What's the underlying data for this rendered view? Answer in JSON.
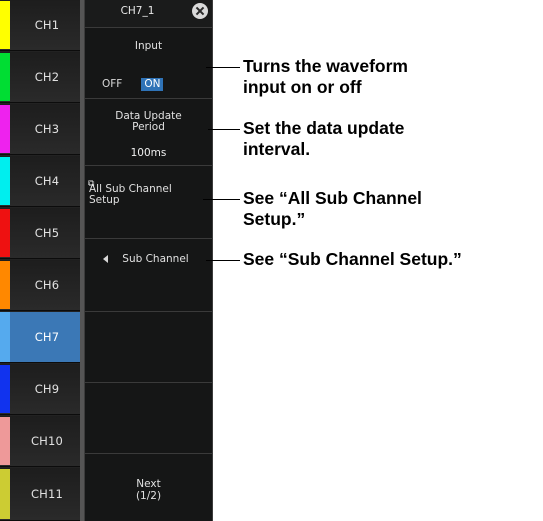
{
  "channels": [
    {
      "label": "CH1",
      "color": "#ffff00"
    },
    {
      "label": "CH2",
      "color": "#00dd33"
    },
    {
      "label": "CH3",
      "color": "#ee22ee"
    },
    {
      "label": "CH4",
      "color": "#00eeee"
    },
    {
      "label": "CH5",
      "color": "#ee1111"
    },
    {
      "label": "CH6",
      "color": "#ff8800"
    },
    {
      "label": "CH7",
      "color": "#55aaee",
      "selected": true
    },
    {
      "label": "CH9",
      "color": "#1133ee"
    },
    {
      "label": "CH10",
      "color": "#ee9999"
    },
    {
      "label": "CH11",
      "color": "#cccc33"
    }
  ],
  "panel": {
    "title": "CH7_1",
    "input": {
      "label": "Input",
      "off": "OFF",
      "on": "ON",
      "state": "ON"
    },
    "data_update": {
      "label_line1": "Data Update",
      "label_line2": "Period",
      "value": "100ms"
    },
    "all_sub": {
      "label_line1": "All Sub Channel",
      "label_line2": "Setup"
    },
    "sub_channel": {
      "label": "Sub Channel"
    },
    "next": {
      "label_line1": "Next",
      "label_line2": "(1/2)"
    }
  },
  "callouts": {
    "input_line1": "Turns the waveform",
    "input_line2": "input on or off",
    "period_line1": "Set the data update",
    "period_line2": "interval.",
    "allsub_line1": "See “All Sub Channel",
    "allsub_line2": "Setup.”",
    "sub": "See “Sub Channel Setup.”"
  },
  "colors": {
    "accent": "#2f73b7",
    "selected_channel": "#3b78b6"
  }
}
